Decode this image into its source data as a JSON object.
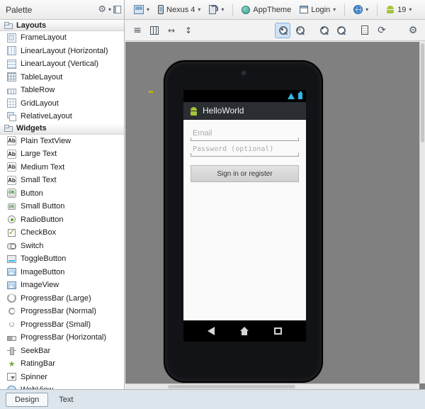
{
  "palette": {
    "title": "Palette",
    "sections": [
      {
        "label": "Layouts",
        "items": [
          {
            "label": "FrameLayout",
            "icon": "pic-fl"
          },
          {
            "label": "LinearLayout (Horizontal)",
            "icon": "pic-llh"
          },
          {
            "label": "LinearLayout (Vertical)",
            "icon": "pic-llv"
          },
          {
            "label": "TableLayout",
            "icon": "pic-tl"
          },
          {
            "label": "TableRow",
            "icon": "pic-trow"
          },
          {
            "label": "GridLayout",
            "icon": "pic-gl"
          },
          {
            "label": "RelativeLayout",
            "icon": "pic-rl"
          }
        ]
      },
      {
        "label": "Widgets",
        "items": [
          {
            "label": "Plain TextView",
            "icon": "pic-ab"
          },
          {
            "label": "Large Text",
            "icon": "pic-ab"
          },
          {
            "label": "Medium Text",
            "icon": "pic-ab"
          },
          {
            "label": "Small Text",
            "icon": "pic-ab"
          },
          {
            "label": "Button",
            "icon": "pic-ok"
          },
          {
            "label": "Small Button",
            "icon": "pic-oksm"
          },
          {
            "label": "RadioButton",
            "icon": "pic-radio"
          },
          {
            "label": "CheckBox",
            "icon": "pic-check"
          },
          {
            "label": "Switch",
            "icon": "pic-switch"
          },
          {
            "label": "ToggleButton",
            "icon": "pic-toggle"
          },
          {
            "label": "ImageButton",
            "icon": "pic-imgbtn"
          },
          {
            "label": "ImageView",
            "icon": "pic-imgview"
          },
          {
            "label": "ProgressBar (Large)",
            "icon": "pic-pbl"
          },
          {
            "label": "ProgressBar (Normal)",
            "icon": "pic-pbn"
          },
          {
            "label": "ProgressBar (Small)",
            "icon": "pic-pbs"
          },
          {
            "label": "ProgressBar (Horizontal)",
            "icon": "pic-pbh"
          },
          {
            "label": "SeekBar",
            "icon": "pic-seek"
          },
          {
            "label": "RatingBar",
            "icon": "pic-rating"
          },
          {
            "label": "Spinner",
            "icon": "pic-spinner"
          },
          {
            "label": "WebView",
            "icon": "pic-web"
          }
        ]
      }
    ]
  },
  "toolbar_top": {
    "device_label": "Nexus 4",
    "theme_label": "AppTheme",
    "activity_label": "Login",
    "api_label": "19"
  },
  "toolbar_design": {
    "zoom_actual": "1:1",
    "zoom_in": "+",
    "zoom_out": "−"
  },
  "icons": {
    "gear": "⚙",
    "dropdown": "▾",
    "list": "≡",
    "resize_h": "↔",
    "resize_v": "↕",
    "refresh": "⟳"
  },
  "device_screen": {
    "app_title": "HelloWorld",
    "email_hint": "Email",
    "password_hint": "Password (optional)",
    "signin_button": "Sign in or register"
  },
  "footer_tabs": [
    {
      "label": "Design"
    },
    {
      "label": "Text"
    }
  ]
}
